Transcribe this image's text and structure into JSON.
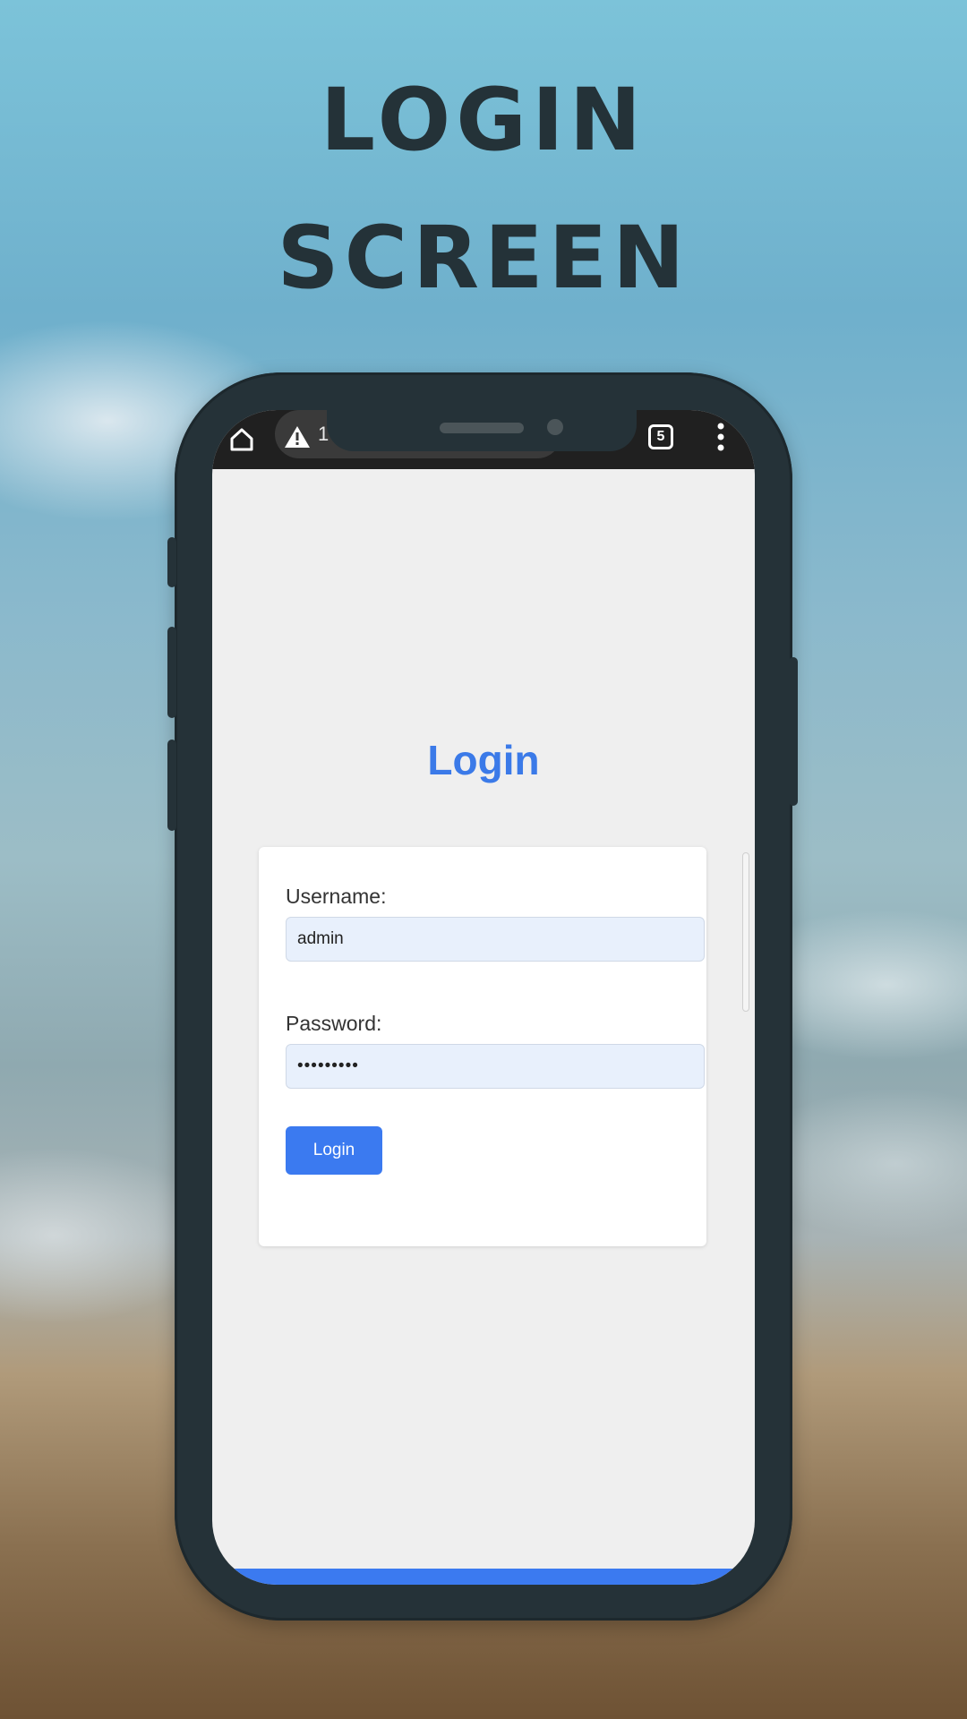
{
  "title": {
    "line1": "LOGIN",
    "line2": "SCREEN"
  },
  "browser": {
    "url_fragment": "1",
    "tab_count": "5",
    "icons": {
      "home": "home-icon",
      "warning": "warning-icon",
      "tabs": "tabs-icon",
      "menu": "more-vert-icon"
    }
  },
  "login": {
    "heading": "Login",
    "username_label": "Username:",
    "username_value": "admin",
    "password_label": "Password:",
    "password_value": "•••••••••",
    "button_label": "Login"
  },
  "colors": {
    "accent": "#3b7af0",
    "heading": "#3b7ae8",
    "phone_frame": "#253238",
    "input_bg": "#e8f0fc"
  }
}
